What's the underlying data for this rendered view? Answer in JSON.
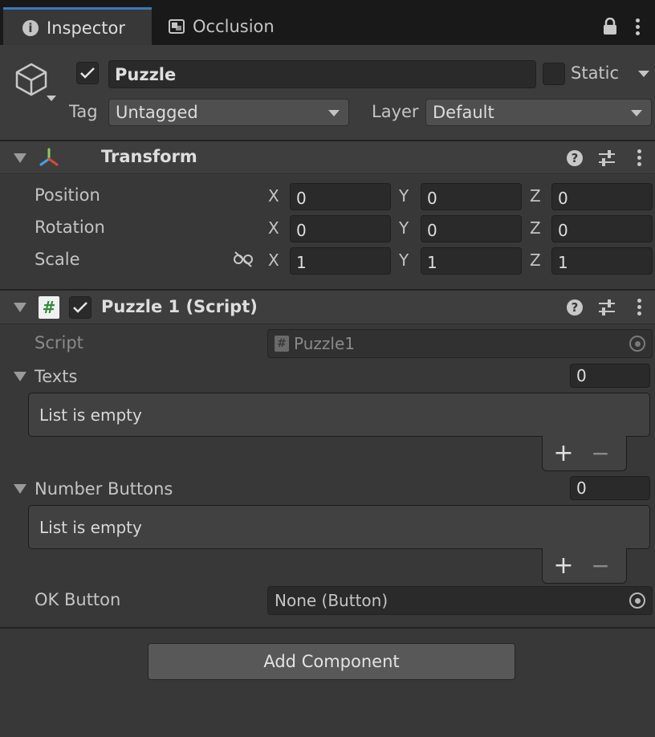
{
  "tabs": {
    "inspector_icon": "i",
    "inspector": "Inspector",
    "occlusion": "Occlusion"
  },
  "header": {
    "name": "Puzzle",
    "static_label": "Static",
    "tag_label": "Tag",
    "tag_value": "Untagged",
    "layer_label": "Layer",
    "layer_value": "Default"
  },
  "transform": {
    "title": "Transform",
    "help": "?",
    "rows": [
      {
        "label": "Position",
        "x": "0",
        "y": "0",
        "z": "0"
      },
      {
        "label": "Rotation",
        "x": "0",
        "y": "0",
        "z": "0"
      },
      {
        "label": "Scale",
        "x": "1",
        "y": "1",
        "z": "1"
      }
    ],
    "axis_x": "X",
    "axis_y": "Y",
    "axis_z": "Z"
  },
  "script_component": {
    "title": "Puzzle 1 (Script)",
    "help": "?",
    "script_label": "Script",
    "script_value": "Puzzle1",
    "script_icon_glyph": "#",
    "texts_label": "Texts",
    "texts_count": "0",
    "texts_empty": "List is empty",
    "number_buttons_label": "Number Buttons",
    "number_buttons_count": "0",
    "number_buttons_empty": "List is empty",
    "ok_button_label": "OK Button",
    "ok_button_value": "None (Button)",
    "plus": "+",
    "minus": "−"
  },
  "add_component": "Add Component",
  "icons": {
    "tab_inspector": "info-icon",
    "tab_occlusion": "occlusion-icon",
    "lock": "lock-icon",
    "menu": "kebab-menu-icon",
    "gameobject": "cube-icon",
    "transform": "transform-axes-icon",
    "script": "csharp-script-icon",
    "help": "help-icon",
    "presets": "sliders-icon",
    "constrain": "unlinked-chain-icon",
    "object_picker": "target-icon"
  },
  "colors": {
    "background": "#383838",
    "tabbar": "#191919",
    "active_tab_accent": "#3a79bb",
    "field_bg": "#2a2a2a",
    "button_bg": "#585858"
  }
}
